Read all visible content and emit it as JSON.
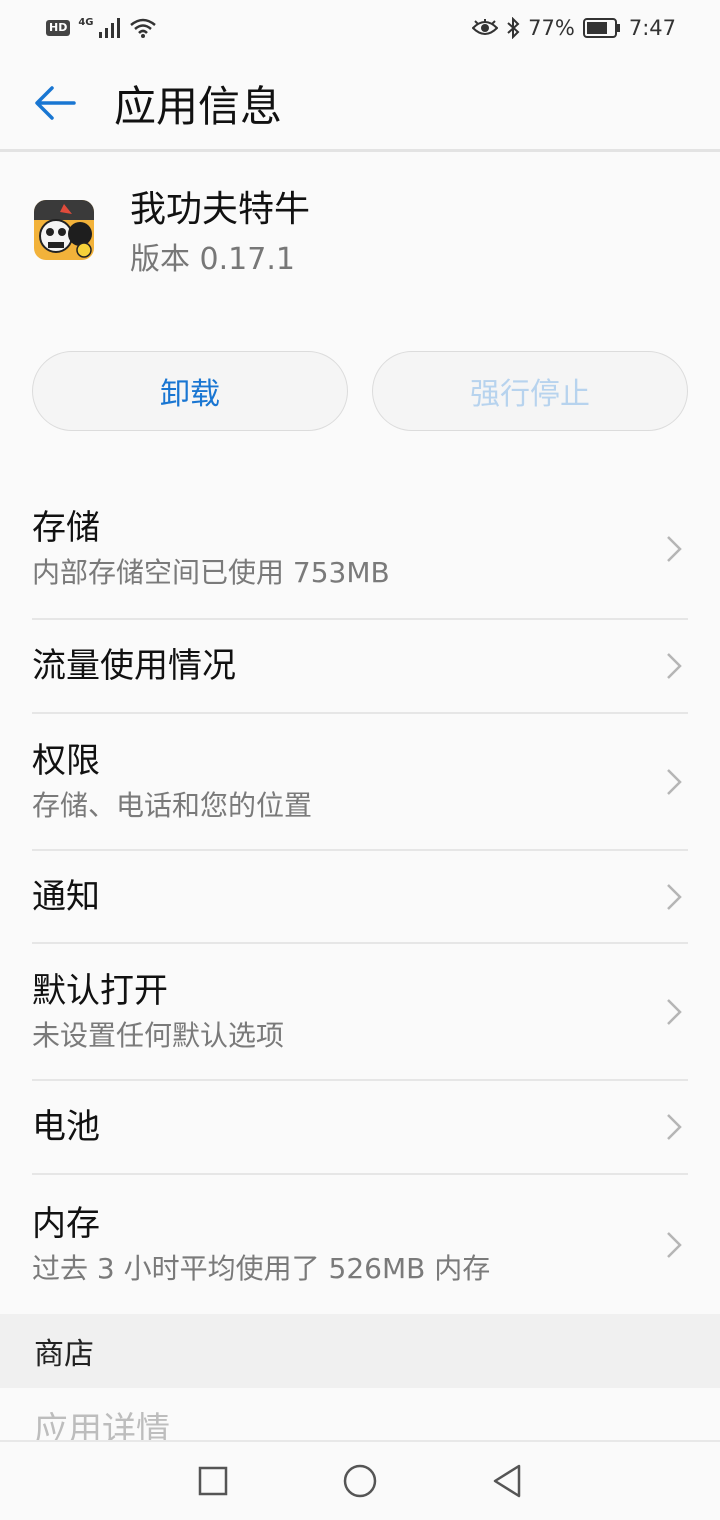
{
  "status_bar": {
    "hd": "HD",
    "network": "4G",
    "battery_pct": "77%",
    "time": "7:47"
  },
  "header": {
    "title": "应用信息"
  },
  "app": {
    "name": "我功夫特牛",
    "version": "版本 0.17.1"
  },
  "actions": {
    "uninstall": "卸载",
    "force_stop": "强行停止"
  },
  "items": [
    {
      "title": "存储",
      "subtitle": "内部存储空间已使用 753MB"
    },
    {
      "title": "流量使用情况",
      "subtitle": ""
    },
    {
      "title": "权限",
      "subtitle": "存储、电话和您的位置"
    },
    {
      "title": "通知",
      "subtitle": ""
    },
    {
      "title": "默认打开",
      "subtitle": "未设置任何默认选项"
    },
    {
      "title": "电池",
      "subtitle": ""
    },
    {
      "title": "内存",
      "subtitle": "过去 3 小时平均使用了 526MB 内存"
    }
  ],
  "store_section": {
    "title": "商店",
    "item": "应用详情"
  },
  "colors": {
    "accent": "#1976d2",
    "disabled": "#b7d3ee"
  }
}
